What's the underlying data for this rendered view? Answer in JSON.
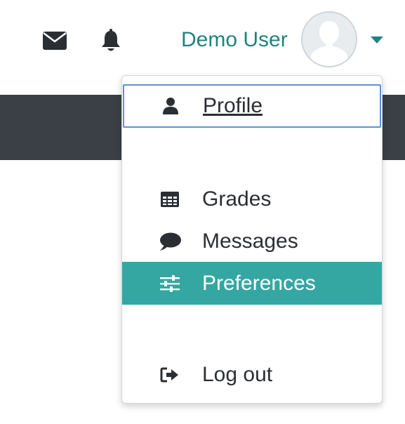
{
  "navbar": {
    "mail_icon": "envelope-icon",
    "bell_icon": "bell-icon",
    "user": {
      "name": "Demo User",
      "avatar_icon": "default-avatar-icon",
      "caret_icon": "caret-down-icon"
    }
  },
  "colors": {
    "accent": "#1d8481",
    "highlight": "#35a7a3",
    "dark_band": "#3b4047",
    "focus_border": "#5c8fe0"
  },
  "user_menu": {
    "items": [
      {
        "label": "Profile",
        "icon": "user-icon",
        "state": "focused"
      },
      {
        "label": "Grades",
        "icon": "table-icon",
        "state": "normal"
      },
      {
        "label": "Messages",
        "icon": "speech-bubble-icon",
        "state": "normal"
      },
      {
        "label": "Preferences",
        "icon": "sliders-icon",
        "state": "hover"
      },
      {
        "label": "Log out",
        "icon": "sign-out-icon",
        "state": "normal"
      }
    ]
  }
}
